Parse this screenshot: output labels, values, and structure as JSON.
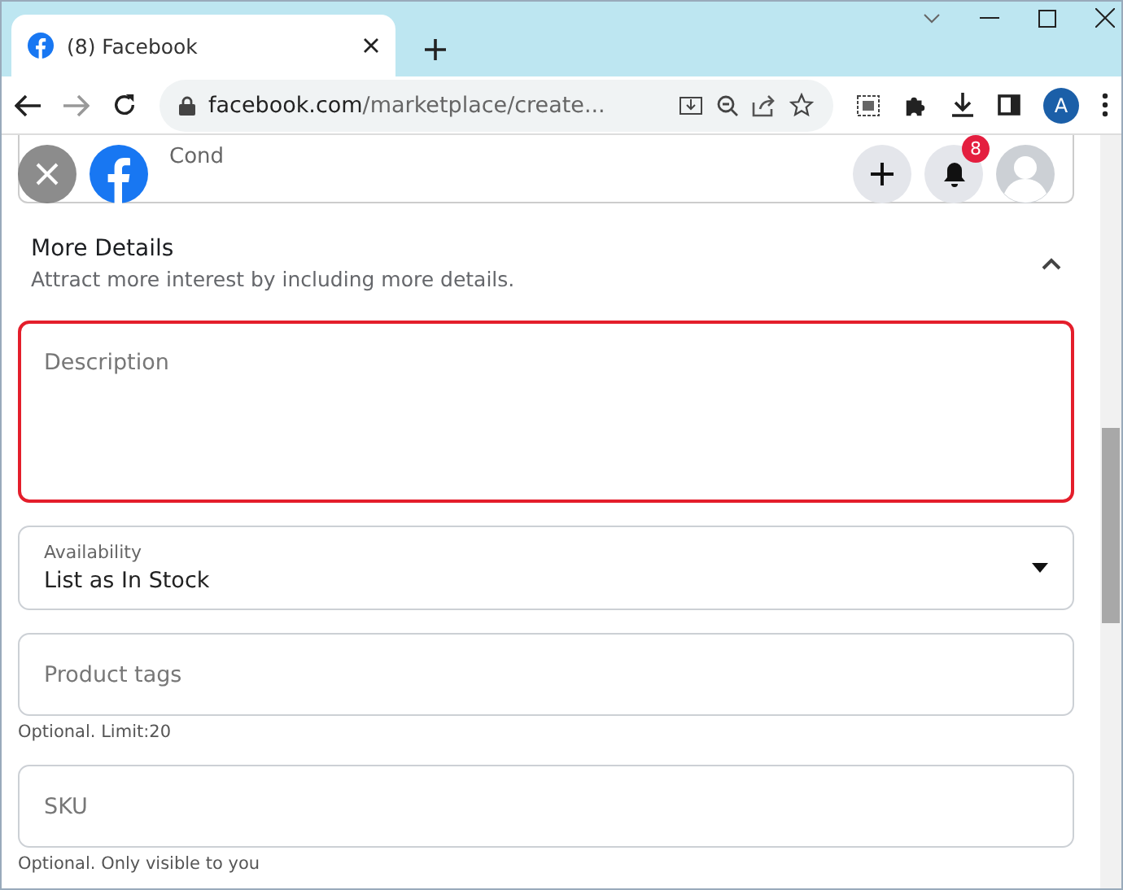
{
  "browser": {
    "tab": {
      "title": "(8) Facebook",
      "selected": true
    },
    "url_domain": "facebook.com",
    "url_path": "/marketplace/create...",
    "profile_initial": "A"
  },
  "header": {
    "cut_field_label": "Cond",
    "notification_count": "8"
  },
  "section": {
    "title": "More Details",
    "subtitle": "Attract more interest by including more details.",
    "expanded": true
  },
  "fields": [
    {
      "kind": "textarea",
      "placeholder": "Description",
      "invalid": true
    },
    {
      "kind": "select",
      "label": "Availability",
      "value": "List as In Stock",
      "invalid": false
    },
    {
      "kind": "input",
      "placeholder": "Product tags",
      "hint": "Optional. Limit:20",
      "invalid": false
    },
    {
      "kind": "input",
      "placeholder": "SKU",
      "hint": "Optional. Only visible to you",
      "invalid": false
    }
  ]
}
